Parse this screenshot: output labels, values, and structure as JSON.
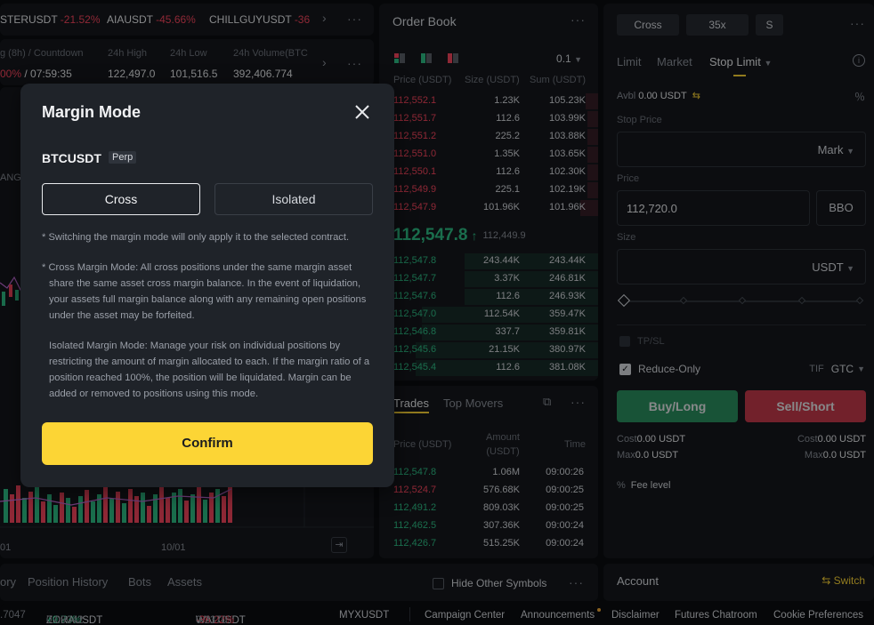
{
  "ticker": {
    "items": [
      {
        "symbol": "STERUSDT",
        "change": "-21.52%"
      },
      {
        "symbol": "AIAUSDT",
        "change": "-45.66%"
      },
      {
        "symbol": "CHILLGUYUSDT",
        "change": "-36"
      }
    ]
  },
  "stats": {
    "labels": [
      "g (8h) / Countdown",
      "24h High",
      "24h Low",
      "24h Volume(BTC"
    ],
    "funding": "00%",
    "countdown": "/ 07:59:35",
    "high": "122,497.0",
    "low": "101,516.5",
    "volume": "392,406.774"
  },
  "chart": {
    "xlabels": [
      "01",
      "10/01"
    ],
    "partial_label": "ANG"
  },
  "orderbook": {
    "title": "Order Book",
    "precision": "0.1",
    "headers": {
      "price": "Price (USDT)",
      "size": "Size (USDT)",
      "sum": "Sum (USDT)"
    },
    "asks": [
      {
        "price": "112,552.1",
        "size": "1.23K",
        "sum": "105.23K"
      },
      {
        "price": "112,551.7",
        "size": "112.6",
        "sum": "103.99K"
      },
      {
        "price": "112,551.2",
        "size": "225.2",
        "sum": "103.88K"
      },
      {
        "price": "112,551.0",
        "size": "1.35K",
        "sum": "103.65K"
      },
      {
        "price": "112,550.1",
        "size": "112.6",
        "sum": "102.30K"
      },
      {
        "price": "112,549.9",
        "size": "225.1",
        "sum": "102.19K"
      },
      {
        "price": "112,547.9",
        "size": "101.96K",
        "sum": "101.96K"
      }
    ],
    "last_price": "112,547.8",
    "mark_price": "112,449.9",
    "bids": [
      {
        "price": "112,547.8",
        "size": "243.44K",
        "sum": "243.44K"
      },
      {
        "price": "112,547.7",
        "size": "3.37K",
        "sum": "246.81K"
      },
      {
        "price": "112,547.6",
        "size": "112.6",
        "sum": "246.93K"
      },
      {
        "price": "112,547.0",
        "size": "112.54K",
        "sum": "359.47K"
      },
      {
        "price": "112,546.8",
        "size": "337.7",
        "sum": "359.81K"
      },
      {
        "price": "112,545.6",
        "size": "21.15K",
        "sum": "380.97K"
      },
      {
        "price": "112,545.4",
        "size": "112.6",
        "sum": "381.08K"
      }
    ]
  },
  "trades": {
    "tabs": [
      "Trades",
      "Top Movers"
    ],
    "headers": {
      "price": "Price (USDT)",
      "amount": "Amount (USDT)",
      "time": "Time"
    },
    "rows": [
      {
        "price": "112,547.8",
        "amount": "1.06M",
        "time": "09:00:26",
        "side": "buy"
      },
      {
        "price": "112,524.7",
        "amount": "576.68K",
        "time": "09:00:25",
        "side": "sell"
      },
      {
        "price": "112,491.2",
        "amount": "809.03K",
        "time": "09:00:25",
        "side": "buy"
      },
      {
        "price": "112,462.5",
        "amount": "307.36K",
        "time": "09:00:24",
        "side": "buy"
      },
      {
        "price": "112,426.7",
        "amount": "515.25K",
        "time": "09:00:24",
        "side": "buy"
      }
    ]
  },
  "orderform": {
    "margin_mode": "Cross",
    "leverage": "35x",
    "asset_mode": "S",
    "tabs": [
      "Limit",
      "Market",
      "Stop Limit"
    ],
    "avbl_label": "Avbl",
    "avbl_value": "0.00 USDT",
    "stop_price_label": "Stop Price",
    "stop_price_type": "Mark",
    "price_label": "Price",
    "price_value": "112,720.0",
    "bbo": "BBO",
    "size_label": "Size",
    "size_unit": "USDT",
    "tpsl": "TP/SL",
    "reduce_only": "Reduce-Only",
    "tif_label": "TIF",
    "tif_value": "GTC",
    "buy": "Buy/Long",
    "sell": "Sell/Short",
    "cost_label": "Cost",
    "cost_value": "0.00 USDT",
    "max_label": "Max",
    "max_value": "0.0 USDT",
    "fee_level": "Fee level"
  },
  "bottom": {
    "tabs": [
      "ory",
      "Position History",
      "Bots",
      "Assets"
    ],
    "hide_other": "Hide Other Symbols"
  },
  "account": {
    "title": "Account",
    "switch": "Switch"
  },
  "footer": {
    "tickers": [
      {
        "price": ".7047"
      },
      {
        "symbol": "ZORAUSDT",
        "change": "+9.73%",
        "price": "0.09042"
      },
      {
        "symbol": "WALUSDT",
        "change": "-36.22%",
        "price": "0.2370"
      },
      {
        "symbol": "MYXUSDT"
      }
    ],
    "links": [
      "Campaign Center",
      "Announcements",
      "Disclaimer",
      "Futures Chatroom",
      "Cookie Preferences"
    ]
  },
  "modal": {
    "title": "Margin Mode",
    "symbol": "BTCUSDT",
    "contract_type": "Perp",
    "options": [
      "Cross",
      "Isolated"
    ],
    "selected": "Cross",
    "note1": "* Switching the margin mode will only apply it to the selected contract.",
    "note2": "* Cross Margin Mode: All cross positions under the same margin asset share the same asset cross margin balance. In the event of liquidation, your assets full margin balance along with any remaining open positions under the asset may be forfeited.",
    "note3": "Isolated Margin Mode: Manage your risk on individual positions by restricting the amount of margin allocated to each. If the margin ratio of a position reached 100%, the position will be liquidated. Margin can be added or removed to positions using this mode.",
    "confirm": "Confirm"
  }
}
